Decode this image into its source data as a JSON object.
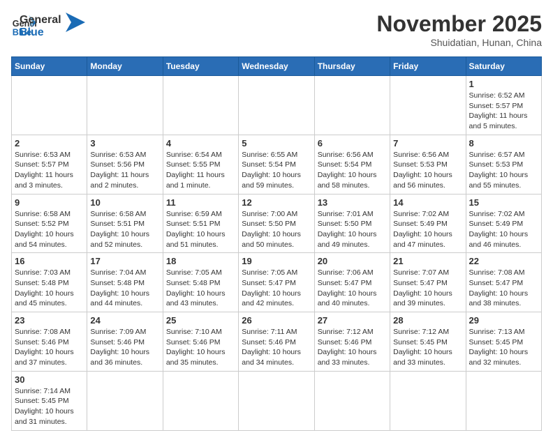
{
  "header": {
    "logo_general": "General",
    "logo_blue": "Blue",
    "month_title": "November 2025",
    "subtitle": "Shuidatian, Hunan, China"
  },
  "weekdays": [
    "Sunday",
    "Monday",
    "Tuesday",
    "Wednesday",
    "Thursday",
    "Friday",
    "Saturday"
  ],
  "weeks": [
    [
      {
        "day": "",
        "info": ""
      },
      {
        "day": "",
        "info": ""
      },
      {
        "day": "",
        "info": ""
      },
      {
        "day": "",
        "info": ""
      },
      {
        "day": "",
        "info": ""
      },
      {
        "day": "",
        "info": ""
      },
      {
        "day": "1",
        "info": "Sunrise: 6:52 AM\nSunset: 5:57 PM\nDaylight: 11 hours\nand 5 minutes."
      }
    ],
    [
      {
        "day": "2",
        "info": "Sunrise: 6:53 AM\nSunset: 5:57 PM\nDaylight: 11 hours\nand 3 minutes."
      },
      {
        "day": "3",
        "info": "Sunrise: 6:53 AM\nSunset: 5:56 PM\nDaylight: 11 hours\nand 2 minutes."
      },
      {
        "day": "4",
        "info": "Sunrise: 6:54 AM\nSunset: 5:55 PM\nDaylight: 11 hours\nand 1 minute."
      },
      {
        "day": "5",
        "info": "Sunrise: 6:55 AM\nSunset: 5:54 PM\nDaylight: 10 hours\nand 59 minutes."
      },
      {
        "day": "6",
        "info": "Sunrise: 6:56 AM\nSunset: 5:54 PM\nDaylight: 10 hours\nand 58 minutes."
      },
      {
        "day": "7",
        "info": "Sunrise: 6:56 AM\nSunset: 5:53 PM\nDaylight: 10 hours\nand 56 minutes."
      },
      {
        "day": "8",
        "info": "Sunrise: 6:57 AM\nSunset: 5:53 PM\nDaylight: 10 hours\nand 55 minutes."
      }
    ],
    [
      {
        "day": "9",
        "info": "Sunrise: 6:58 AM\nSunset: 5:52 PM\nDaylight: 10 hours\nand 54 minutes."
      },
      {
        "day": "10",
        "info": "Sunrise: 6:58 AM\nSunset: 5:51 PM\nDaylight: 10 hours\nand 52 minutes."
      },
      {
        "day": "11",
        "info": "Sunrise: 6:59 AM\nSunset: 5:51 PM\nDaylight: 10 hours\nand 51 minutes."
      },
      {
        "day": "12",
        "info": "Sunrise: 7:00 AM\nSunset: 5:50 PM\nDaylight: 10 hours\nand 50 minutes."
      },
      {
        "day": "13",
        "info": "Sunrise: 7:01 AM\nSunset: 5:50 PM\nDaylight: 10 hours\nand 49 minutes."
      },
      {
        "day": "14",
        "info": "Sunrise: 7:02 AM\nSunset: 5:49 PM\nDaylight: 10 hours\nand 47 minutes."
      },
      {
        "day": "15",
        "info": "Sunrise: 7:02 AM\nSunset: 5:49 PM\nDaylight: 10 hours\nand 46 minutes."
      }
    ],
    [
      {
        "day": "16",
        "info": "Sunrise: 7:03 AM\nSunset: 5:48 PM\nDaylight: 10 hours\nand 45 minutes."
      },
      {
        "day": "17",
        "info": "Sunrise: 7:04 AM\nSunset: 5:48 PM\nDaylight: 10 hours\nand 44 minutes."
      },
      {
        "day": "18",
        "info": "Sunrise: 7:05 AM\nSunset: 5:48 PM\nDaylight: 10 hours\nand 43 minutes."
      },
      {
        "day": "19",
        "info": "Sunrise: 7:05 AM\nSunset: 5:47 PM\nDaylight: 10 hours\nand 42 minutes."
      },
      {
        "day": "20",
        "info": "Sunrise: 7:06 AM\nSunset: 5:47 PM\nDaylight: 10 hours\nand 40 minutes."
      },
      {
        "day": "21",
        "info": "Sunrise: 7:07 AM\nSunset: 5:47 PM\nDaylight: 10 hours\nand 39 minutes."
      },
      {
        "day": "22",
        "info": "Sunrise: 7:08 AM\nSunset: 5:47 PM\nDaylight: 10 hours\nand 38 minutes."
      }
    ],
    [
      {
        "day": "23",
        "info": "Sunrise: 7:08 AM\nSunset: 5:46 PM\nDaylight: 10 hours\nand 37 minutes."
      },
      {
        "day": "24",
        "info": "Sunrise: 7:09 AM\nSunset: 5:46 PM\nDaylight: 10 hours\nand 36 minutes."
      },
      {
        "day": "25",
        "info": "Sunrise: 7:10 AM\nSunset: 5:46 PM\nDaylight: 10 hours\nand 35 minutes."
      },
      {
        "day": "26",
        "info": "Sunrise: 7:11 AM\nSunset: 5:46 PM\nDaylight: 10 hours\nand 34 minutes."
      },
      {
        "day": "27",
        "info": "Sunrise: 7:12 AM\nSunset: 5:46 PM\nDaylight: 10 hours\nand 33 minutes."
      },
      {
        "day": "28",
        "info": "Sunrise: 7:12 AM\nSunset: 5:45 PM\nDaylight: 10 hours\nand 33 minutes."
      },
      {
        "day": "29",
        "info": "Sunrise: 7:13 AM\nSunset: 5:45 PM\nDaylight: 10 hours\nand 32 minutes."
      }
    ],
    [
      {
        "day": "30",
        "info": "Sunrise: 7:14 AM\nSunset: 5:45 PM\nDaylight: 10 hours\nand 31 minutes."
      },
      {
        "day": "",
        "info": ""
      },
      {
        "day": "",
        "info": ""
      },
      {
        "day": "",
        "info": ""
      },
      {
        "day": "",
        "info": ""
      },
      {
        "day": "",
        "info": ""
      },
      {
        "day": "",
        "info": ""
      }
    ]
  ]
}
